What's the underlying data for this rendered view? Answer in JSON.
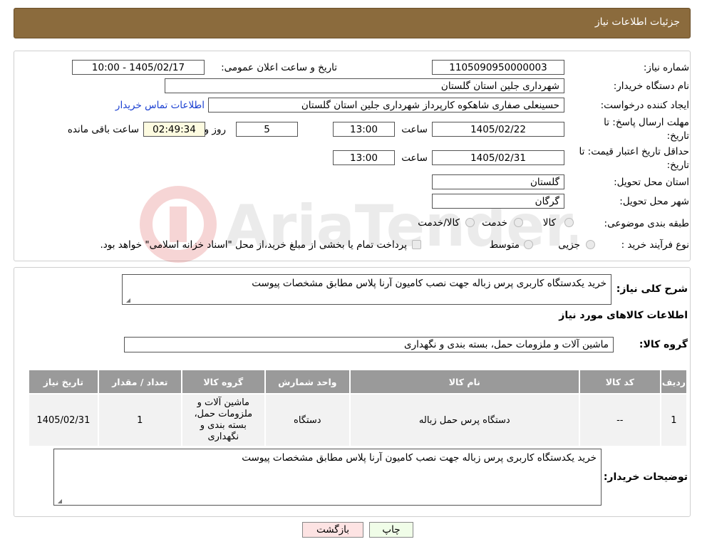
{
  "header": {
    "title": "جزئیات اطلاعات نیاز"
  },
  "fields": {
    "need_number_label": "شماره نیاز:",
    "need_number": "1105090950000003",
    "announce_label": "تاریخ و ساعت اعلان عمومی:",
    "announce_value": "1405/02/17 - 10:00",
    "buyer_org_label": "نام دستگاه خریدار:",
    "buyer_org": "شهرداری جلین استان گلستان",
    "creator_label": "ایجاد کننده درخواست:",
    "creator": "حسینعلی صفاری شاهکوه کارپرداز شهرداری جلین استان گلستان",
    "contact_link": "اطلاعات تماس خریدار",
    "deadline_label_1": "مهلت ارسال پاسخ: تا",
    "deadline_label_2": "تاریخ:",
    "deadline_date": "1405/02/22",
    "time_label": "ساعت",
    "deadline_time": "13:00",
    "days_value": "5",
    "days_label": "روز و",
    "remaining_time": "02:49:34",
    "remaining_label": "ساعت باقی مانده",
    "validity_label_1": "حداقل تاریخ اعتبار قیمت: تا",
    "validity_label_2": "تاریخ:",
    "validity_date": "1405/02/31",
    "validity_time": "13:00",
    "province_label": "استان محل تحویل:",
    "province": "گلستان",
    "city_label": "شهر محل تحویل:",
    "city": "گرگان",
    "category_label": "طبقه بندی موضوعی:",
    "category_options": [
      "کالا",
      "خدمت",
      "کالا/خدمت"
    ],
    "process_label": "نوع فرآیند خرید :",
    "process_options": [
      "جزیی",
      "متوسط"
    ],
    "process_note": "پرداخت تمام یا بخشی از مبلغ خرید،از محل \"اسناد خزانه اسلامی\" خواهد بود."
  },
  "summary": {
    "general_desc_label": "شرح کلی نیاز:",
    "general_desc": "خرید یکدستگاه کاربری پرس زباله جهت نصب کامیون آرنا پلاس مطابق مشخصات پیوست",
    "goods_info_title": "اطلاعات کالاهای مورد نیاز",
    "goods_group_label": "گروه کالا:",
    "goods_group": "ماشین آلات و ملزومات حمل، بسته بندی و نگهداری"
  },
  "table": {
    "headers": [
      "ردیف",
      "کد کالا",
      "نام کالا",
      "واحد شمارش",
      "گروه کالا",
      "تعداد / مقدار",
      "تاریخ نیاز"
    ],
    "rows": [
      [
        "1",
        "--",
        "دستگاه پرس حمل زباله",
        "دستگاه",
        "ماشین آلات و ملزومات حمل، بسته بندی و نگهداری",
        "1",
        "1405/02/31"
      ]
    ]
  },
  "buyer_notes": {
    "label": "توضیحات خریدار:",
    "text": "خرید یکدستگاه کاربری پرس زباله جهت نصب کامیون آرنا پلاس مطابق مشخصات پیوست"
  },
  "buttons": {
    "print": "چاپ",
    "back": "بازگشت"
  },
  "colors": {
    "header_bg": "#8b6b3d",
    "table_header_bg": "#9a9a9a",
    "link": "#1a3fd1",
    "back_button_bg": "#fde3e3"
  }
}
